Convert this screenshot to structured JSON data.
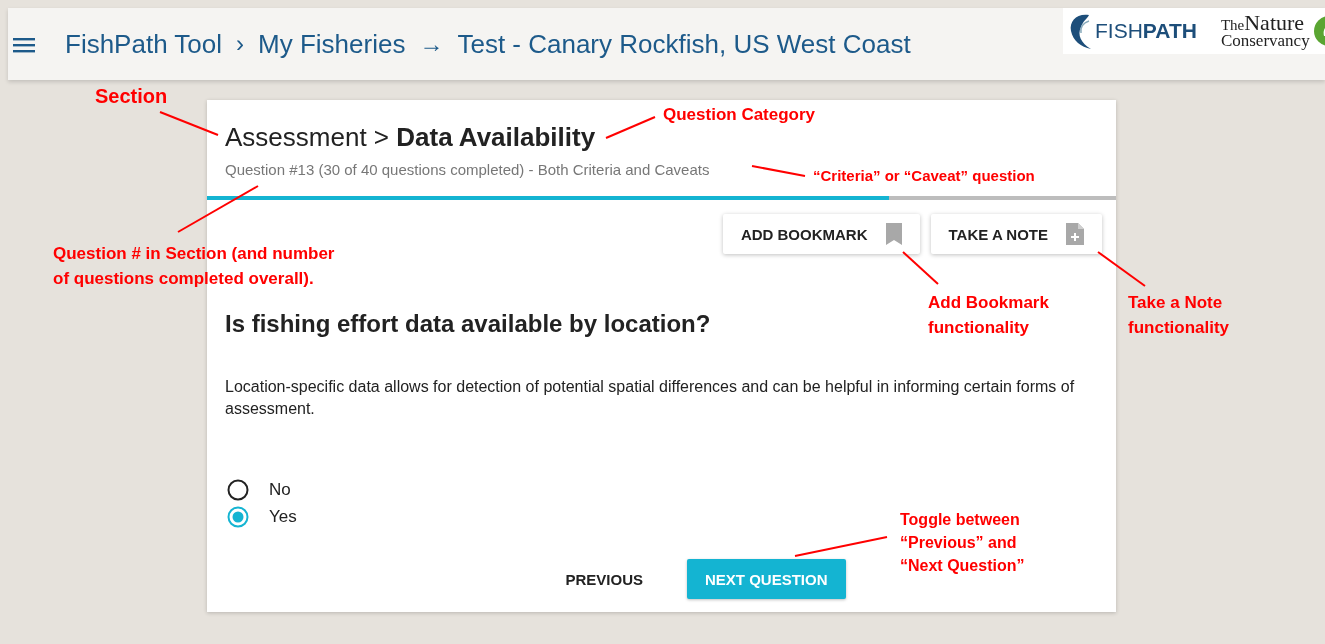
{
  "header": {
    "breadcrumb": [
      {
        "label": "FishPath Tool"
      },
      {
        "separator": "›",
        "label": "My Fisheries"
      },
      {
        "separator": "→",
        "label": "Test - Canary Rockfish, US West Coast"
      }
    ],
    "logos": {
      "fishpath": "FISH**PATH**",
      "tnc_small": "The",
      "tnc_main": "Nature",
      "tnc_sub": "Conservancy"
    }
  },
  "card": {
    "title": "Assessment > **Data Availability**",
    "subtitle": "Question #13 (30 of 40 questions completed) - Both Criteria and Caveats",
    "progress": {
      "level": 0.75
    },
    "actions": [
      {
        "label": "ADD BOOKMARK",
        "kind": "bookmark"
      },
      {
        "label": "TAKE A NOTE",
        "kind": "note"
      }
    ],
    "question": "Is fishing effort data available by location?",
    "description": "Location-specific data allows for detection of potential spatial differences and can be helpful in informing certain forms of assessment.",
    "options": [
      {
        "label": "No",
        "selected": false
      },
      {
        "label": "Yes",
        "selected": true
      }
    ],
    "nav": [
      {
        "label": "PREVIOUS",
        "kind": "text"
      },
      {
        "label": "NEXT QUESTION",
        "kind": "primary"
      }
    ]
  },
  "annotations": [
    {
      "text": "Section"
    },
    {
      "text": "Question Category"
    },
    {
      "text": "“Criteria” or “Caveat” question"
    },
    {
      "text": "Question # in Section (and number of questions completed overall)."
    },
    {
      "text": "Add Bookmark functionality"
    },
    {
      "text": "Take a Note functionality"
    },
    {
      "text": "Toggle between “Previous” and “Next Question”"
    }
  ]
}
